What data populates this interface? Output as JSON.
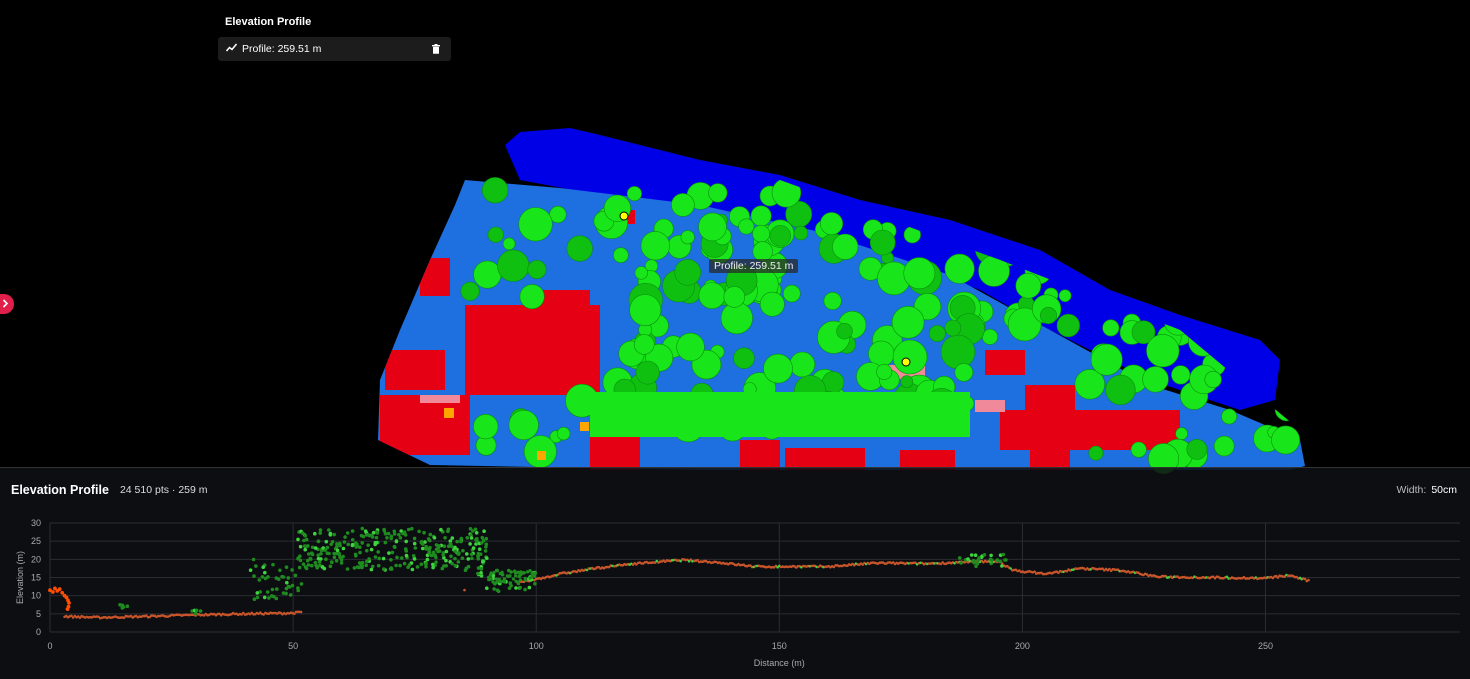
{
  "tool_panel": {
    "title": "Elevation Profile",
    "profile_item": "Profile: 259.51 m"
  },
  "map": {
    "profile_label": "Profile: 259.51 m"
  },
  "profile_panel": {
    "title": "Elevation Profile",
    "stats": "24 510 pts · 259 m",
    "width_label": "Width:",
    "width_value": "50cm"
  },
  "icons": {
    "profile": "line-chart-icon",
    "delete": "trash-icon",
    "expand": "chevron-right-icon"
  },
  "colors": {
    "ground": "#c8552a",
    "vegetation": "#1f8a1f",
    "vegetation_light": "#3fd43f",
    "unclassified": "#ff4d00",
    "accent": "#e0204a"
  },
  "chart_data": {
    "type": "scatter",
    "xlabel": "Distance (m)",
    "ylabel": "Elevation (m)",
    "xlim": [
      0,
      290
    ],
    "ylim": [
      0,
      30
    ],
    "xticks": [
      0,
      50,
      100,
      150,
      200,
      250
    ],
    "yticks": [
      0,
      5,
      10,
      15,
      20,
      25,
      30
    ],
    "grid": true,
    "ground_profile": [
      [
        3,
        4.3
      ],
      [
        10,
        4.0
      ],
      [
        20,
        4.3
      ],
      [
        30,
        4.7
      ],
      [
        40,
        5.0
      ],
      [
        50,
        5.2
      ],
      [
        96,
        13.5
      ],
      [
        100,
        14.5
      ],
      [
        105,
        16.0
      ],
      [
        112,
        17.5
      ],
      [
        120,
        18.8
      ],
      [
        130,
        19.8
      ],
      [
        137,
        19.2
      ],
      [
        145,
        18.0
      ],
      [
        160,
        18.0
      ],
      [
        170,
        19.0
      ],
      [
        180,
        18.8
      ],
      [
        188,
        19.2
      ],
      [
        195,
        19.5
      ],
      [
        198,
        17.0
      ],
      [
        205,
        16.0
      ],
      [
        212,
        17.5
      ],
      [
        220,
        17.0
      ],
      [
        228,
        15.2
      ],
      [
        240,
        15.0
      ],
      [
        250,
        14.8
      ],
      [
        255,
        15.6
      ],
      [
        259,
        14.0
      ]
    ],
    "vegetation_clusters": [
      {
        "x": [
          41,
          52
        ],
        "y": [
          9,
          20
        ],
        "n": 45
      },
      {
        "x": [
          51,
          90
        ],
        "y": [
          17,
          28.5
        ],
        "n": 330
      },
      {
        "x": [
          88,
          100
        ],
        "y": [
          11,
          17
        ],
        "n": 45
      },
      {
        "x": [
          187,
          197
        ],
        "y": [
          18,
          21.5
        ],
        "n": 30
      },
      {
        "x": [
          14,
          16
        ],
        "y": [
          6.5,
          7.5
        ],
        "n": 5
      },
      {
        "x": [
          29,
          31
        ],
        "y": [
          5.0,
          6.3
        ],
        "n": 5
      }
    ],
    "unclassified_points": [
      [
        0,
        11.5
      ],
      [
        0.6,
        11.0
      ],
      [
        1.0,
        12.0
      ],
      [
        1.5,
        11.3
      ],
      [
        2.0,
        11.8
      ],
      [
        2.5,
        10.8
      ],
      [
        3.0,
        10.0
      ],
      [
        3.4,
        9.5
      ],
      [
        3.7,
        8.7
      ],
      [
        3.9,
        8.0
      ],
      [
        3.8,
        7.0
      ],
      [
        3.6,
        6.3
      ]
    ]
  }
}
